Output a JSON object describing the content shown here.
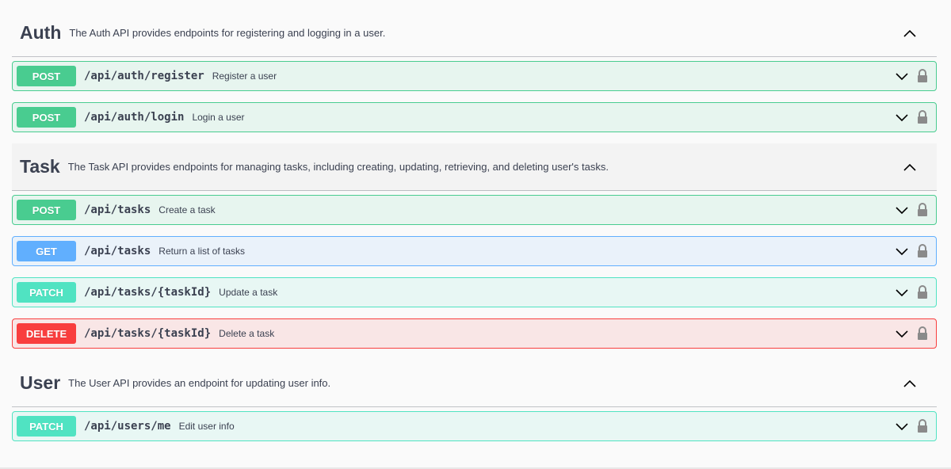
{
  "tags": [
    {
      "name": "Auth",
      "description": "The Auth API provides endpoints for registering and logging in a user.",
      "operations": [
        {
          "method": "POST",
          "path": "/api/auth/register",
          "summary": "Register a user"
        },
        {
          "method": "POST",
          "path": "/api/auth/login",
          "summary": "Login a user"
        }
      ]
    },
    {
      "name": "Task",
      "description": "The Task API provides endpoints for managing tasks, including creating, updating, retrieving, and deleting user's tasks.",
      "operations": [
        {
          "method": "POST",
          "path": "/api/tasks",
          "summary": "Create a task"
        },
        {
          "method": "GET",
          "path": "/api/tasks",
          "summary": "Return a list of tasks"
        },
        {
          "method": "PATCH",
          "path": "/api/tasks/{taskId}",
          "summary": "Update a task"
        },
        {
          "method": "DELETE",
          "path": "/api/tasks/{taskId}",
          "summary": "Delete a task"
        }
      ]
    },
    {
      "name": "User",
      "description": "The User API provides an endpoint for updating user info.",
      "operations": [
        {
          "method": "PATCH",
          "path": "/api/users/me",
          "summary": "Edit user info"
        }
      ]
    }
  ],
  "icons": {
    "tag_toggle": "chevron-up-icon",
    "op_expand": "chevron-down-icon",
    "auth": "lock-icon"
  },
  "colors": {
    "post": "#49cc90",
    "get": "#61affe",
    "patch": "#50e3c2",
    "delete": "#f93e3e",
    "text": "#3b4151"
  }
}
